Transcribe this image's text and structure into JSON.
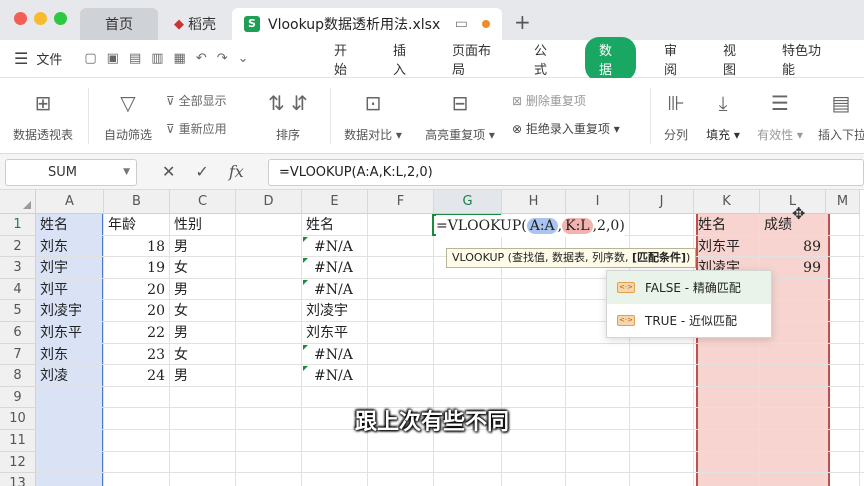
{
  "tabs": {
    "home": "首页",
    "docer": "稻壳",
    "file": "Vlookup数据透析用法.xlsx",
    "new_tab": "+"
  },
  "menu": {
    "file": "文件",
    "items": [
      "开始",
      "插入",
      "页面布局",
      "公式",
      "数据",
      "审阅",
      "视图",
      "特色功能"
    ],
    "active_index": 4
  },
  "ribbon": {
    "pivot": "数据透视表",
    "autofilter": "自动筛选",
    "show_all": "全部显示",
    "reapply": "重新应用",
    "sort": "排序",
    "compare": "数据对比",
    "highlight_dup": "高亮重复项",
    "remove_dup": "删除重复项",
    "reject_dup": "拒绝录入重复项",
    "split": "分列",
    "fill": "填充",
    "validity": "有效性",
    "insert_dropdown": "插入下拉"
  },
  "formula_bar": {
    "name_box": "SUM",
    "formula": "=VLOOKUP(A:A,K:L,2,0)",
    "fx": "fx"
  },
  "columns": [
    "A",
    "B",
    "C",
    "D",
    "E",
    "F",
    "G",
    "H",
    "I",
    "J",
    "K",
    "L",
    "M"
  ],
  "rows": [
    "1",
    "2",
    "3",
    "4",
    "5",
    "6",
    "7",
    "8",
    "9",
    "10",
    "11",
    "12",
    "13"
  ],
  "colA": [
    "姓名",
    "刘东",
    "刘宇",
    "刘平",
    "刘凌宇",
    "刘东平",
    "刘东",
    "刘凌"
  ],
  "colB": [
    "年龄",
    "18",
    "19",
    "20",
    "20",
    "22",
    "23",
    "24"
  ],
  "colC": [
    "性别",
    "男",
    "女",
    "男",
    "女",
    "男",
    "女",
    "男"
  ],
  "colE": [
    "姓名",
    "#N/A",
    "#N/A",
    "#N/A",
    "刘凌宇",
    "刘东平",
    "#N/A",
    "#N/A"
  ],
  "colK": [
    "姓名",
    "刘东平",
    "刘凌宇"
  ],
  "colL": [
    "成绩",
    "89",
    "99"
  ],
  "formula_cell": {
    "prefix": "=VLOOKUP(",
    "ref1": "A:A",
    "comma1": ",",
    "ref2": "K:L",
    "suffix": ",2,0)"
  },
  "tooltip": {
    "text": "VLOOKUP (查找值, 数据表, 列序数, ",
    "bold": "[匹配条件]",
    "end": ")"
  },
  "dropdown": [
    "FALSE - 精确匹配",
    "TRUE - 近似匹配"
  ],
  "subtitle": "跟上次有些不同"
}
